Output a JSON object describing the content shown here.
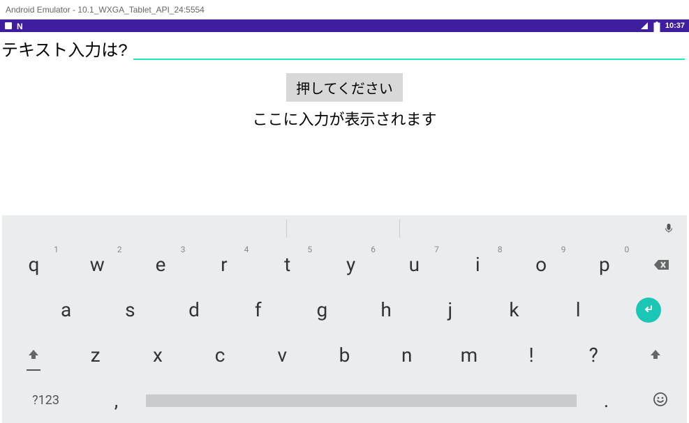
{
  "window": {
    "title": "Android Emulator - 10.1_WXGA_Tablet_API_24:5554"
  },
  "statusbar": {
    "time": "10:37"
  },
  "app": {
    "input_label": "テキスト入力は?",
    "input_value": "",
    "button_label": "押してください",
    "display_text": "ここに入力が表示されます"
  },
  "keyboard": {
    "row1": [
      {
        "k": "q",
        "h": "1"
      },
      {
        "k": "w",
        "h": "2"
      },
      {
        "k": "e",
        "h": "3"
      },
      {
        "k": "r",
        "h": "4"
      },
      {
        "k": "t",
        "h": "5"
      },
      {
        "k": "y",
        "h": "6"
      },
      {
        "k": "u",
        "h": "7"
      },
      {
        "k": "i",
        "h": "8"
      },
      {
        "k": "o",
        "h": "9"
      },
      {
        "k": "p",
        "h": "0"
      }
    ],
    "row2": [
      "a",
      "s",
      "d",
      "f",
      "g",
      "h",
      "j",
      "k",
      "l"
    ],
    "row3": [
      "z",
      "x",
      "c",
      "v",
      "b",
      "n",
      "m",
      "!",
      "?"
    ],
    "symbol_key": "?123",
    "comma": ",",
    "period": "."
  }
}
